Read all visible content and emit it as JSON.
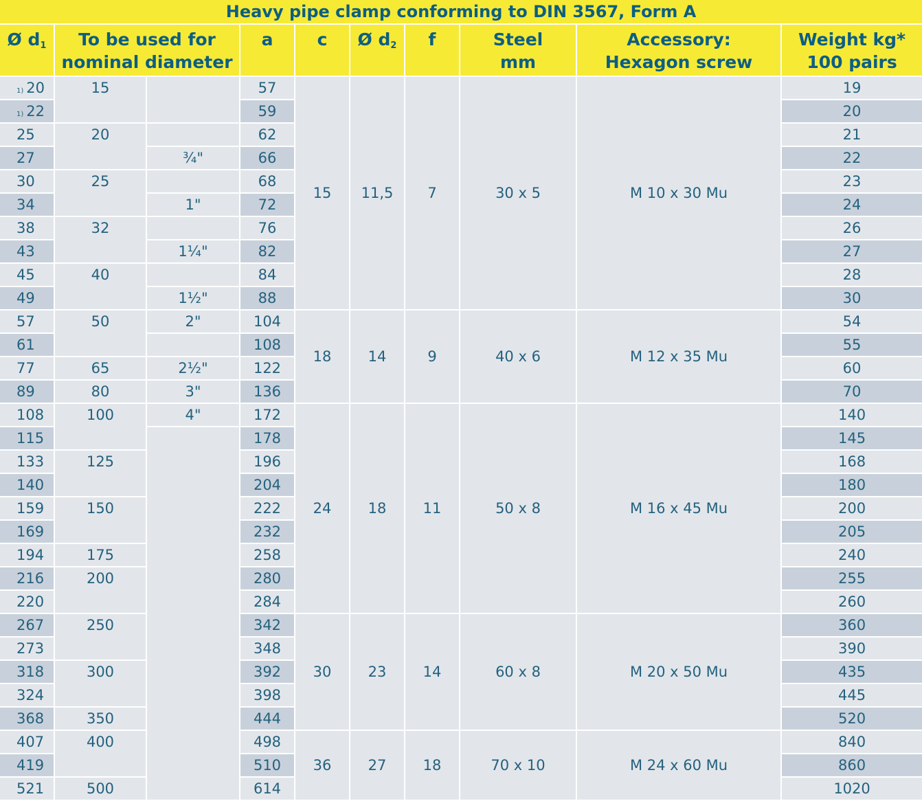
{
  "title": "Heavy pipe clamp conforming to DIN 3567, Form A",
  "headers": {
    "d1": "Ø d",
    "d1_sub": "1",
    "nominal_1": "To be used for",
    "nominal_2": "nominal diameter",
    "a": "a",
    "c": "c",
    "d2": "Ø d",
    "d2_sub": "2",
    "f": "f",
    "steel_1": "Steel",
    "steel_2": "mm",
    "acc_1": "Accessory:",
    "acc_2": "Hexagon screw",
    "weight_1": "Weight kg*",
    "weight_2": "100 pairs"
  },
  "colors": {
    "header_bg": "#f6ea35",
    "header_text": "#0d5e83",
    "cell_light": "#e2e6ea",
    "cell_dark": "#c8d1db",
    "cell_text": "#24617f"
  },
  "rows": [
    {
      "note": "1)",
      "d1": "20",
      "dn": "15",
      "inch": "",
      "a": "57",
      "w": "19"
    },
    {
      "note": "1)",
      "d1": "22",
      "dn": "",
      "inch": "",
      "a": "59",
      "w": "20"
    },
    {
      "note": "",
      "d1": "25",
      "dn": "20",
      "inch": "",
      "a": "62",
      "w": "21"
    },
    {
      "note": "",
      "d1": "27",
      "dn": "",
      "inch": "¾\"",
      "a": "66",
      "w": "22"
    },
    {
      "note": "",
      "d1": "30",
      "dn": "25",
      "inch": "",
      "a": "68",
      "w": "23"
    },
    {
      "note": "",
      "d1": "34",
      "dn": "",
      "inch": "1\"",
      "a": "72",
      "w": "24"
    },
    {
      "note": "",
      "d1": "38",
      "dn": "32",
      "inch": "",
      "a": "76",
      "w": "26"
    },
    {
      "note": "",
      "d1": "43",
      "dn": "",
      "inch": "1¼\"",
      "a": "82",
      "w": "27"
    },
    {
      "note": "",
      "d1": "45",
      "dn": "40",
      "inch": "",
      "a": "84",
      "w": "28"
    },
    {
      "note": "",
      "d1": "49",
      "dn": "",
      "inch": "1½\"",
      "a": "88",
      "w": "30"
    },
    {
      "note": "",
      "d1": "57",
      "dn": "50",
      "inch": "2\"",
      "a": "104",
      "w": "54"
    },
    {
      "note": "",
      "d1": "61",
      "dn": "",
      "inch": "",
      "a": "108",
      "w": "55"
    },
    {
      "note": "",
      "d1": "77",
      "dn": "65",
      "inch": "2½\"",
      "a": "122",
      "w": "60"
    },
    {
      "note": "",
      "d1": "89",
      "dn": "80",
      "inch": "3\"",
      "a": "136",
      "w": "70"
    },
    {
      "note": "",
      "d1": "108",
      "dn": "100",
      "inch": "4\"",
      "a": "172",
      "w": "140"
    },
    {
      "note": "",
      "d1": "115",
      "dn": "",
      "inch": "",
      "a": "178",
      "w": "145"
    },
    {
      "note": "",
      "d1": "133",
      "dn": "125",
      "inch": "",
      "a": "196",
      "w": "168"
    },
    {
      "note": "",
      "d1": "140",
      "dn": "",
      "inch": "",
      "a": "204",
      "w": "180"
    },
    {
      "note": "",
      "d1": "159",
      "dn": "150",
      "inch": "",
      "a": "222",
      "w": "200"
    },
    {
      "note": "",
      "d1": "169",
      "dn": "",
      "inch": "",
      "a": "232",
      "w": "205"
    },
    {
      "note": "",
      "d1": "194",
      "dn": "175",
      "inch": "",
      "a": "258",
      "w": "240"
    },
    {
      "note": "",
      "d1": "216",
      "dn": "200",
      "inch": "",
      "a": "280",
      "w": "255"
    },
    {
      "note": "",
      "d1": "220",
      "dn": "",
      "inch": "",
      "a": "284",
      "w": "260"
    },
    {
      "note": "",
      "d1": "267",
      "dn": "250",
      "inch": "",
      "a": "342",
      "w": "360"
    },
    {
      "note": "",
      "d1": "273",
      "dn": "",
      "inch": "",
      "a": "348",
      "w": "390"
    },
    {
      "note": "",
      "d1": "318",
      "dn": "300",
      "inch": "",
      "a": "392",
      "w": "435"
    },
    {
      "note": "",
      "d1": "324",
      "dn": "",
      "inch": "",
      "a": "398",
      "w": "445"
    },
    {
      "note": "",
      "d1": "368",
      "dn": "350",
      "inch": "",
      "a": "444",
      "w": "520"
    },
    {
      "note": "",
      "d1": "407",
      "dn": "400",
      "inch": "",
      "a": "498",
      "w": "840"
    },
    {
      "note": "",
      "d1": "419",
      "dn": "",
      "inch": "",
      "a": "510",
      "w": "860"
    },
    {
      "note": "",
      "d1": "521",
      "dn": "500",
      "inch": "",
      "a": "614",
      "w": "1020"
    }
  ],
  "groups": [
    {
      "start": 0,
      "span": 10,
      "c": "15",
      "d2": "11,5",
      "f": "7",
      "steel": "30 x 5",
      "screw": "M 10 x 30 Mu"
    },
    {
      "start": 10,
      "span": 4,
      "c": "18",
      "d2": "14",
      "f": "9",
      "steel": "40 x 6",
      "screw": "M 12 x 35 Mu"
    },
    {
      "start": 14,
      "span": 9,
      "c": "24",
      "d2": "18",
      "f": "11",
      "steel": "50 x 8",
      "screw": "M 16 x 45 Mu"
    },
    {
      "start": 23,
      "span": 5,
      "c": "30",
      "d2": "23",
      "f": "14",
      "steel": "60 x 8",
      "screw": "M 20 x 50 Mu"
    },
    {
      "start": 28,
      "span": 3,
      "c": "36",
      "d2": "27",
      "f": "18",
      "steel": "70 x 10",
      "screw": "M 24 x 60 Mu"
    }
  ]
}
